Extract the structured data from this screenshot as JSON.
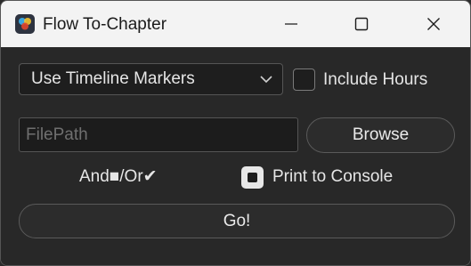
{
  "window": {
    "title": "Flow To-Chapter",
    "app_icon": "davinci-resolve-icon",
    "controls": [
      "minimize-icon",
      "maximize-icon",
      "close-icon"
    ]
  },
  "form": {
    "marker_source": {
      "selected": "Use Timeline Markers",
      "icon": "chevron-down-icon"
    },
    "include_hours": {
      "label": "Include Hours",
      "checked": false
    },
    "filepath": {
      "placeholder": "FilePath",
      "value": ""
    },
    "browse_label": "Browse",
    "andor_label": "And■/Or✔",
    "print_to_console": {
      "label": "Print to Console",
      "checked": true
    },
    "go_label": "Go!"
  },
  "colors": {
    "titlebar_bg": "#f3f3f3",
    "window_bg": "#282828",
    "text": "#e6e6e6",
    "placeholder": "#6f6f6f"
  }
}
